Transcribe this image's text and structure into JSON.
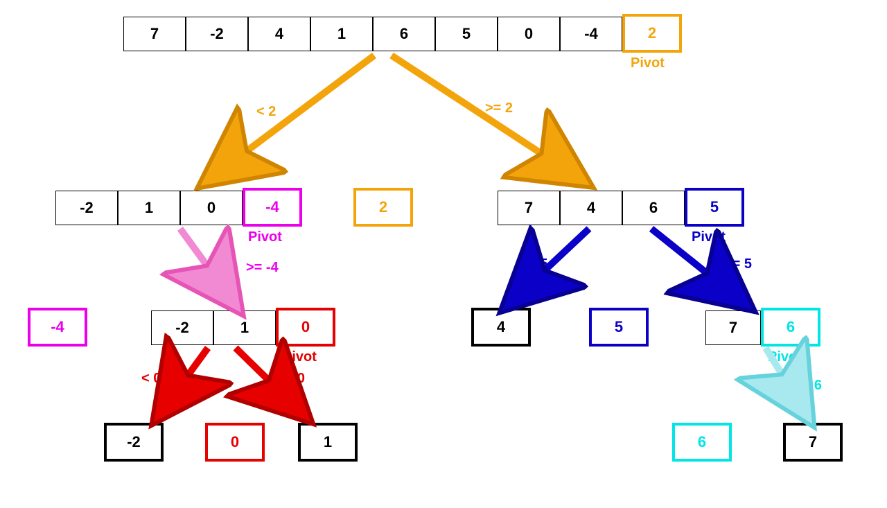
{
  "diagram_type": "quicksort-partition-tree",
  "colors": {
    "orange": "#f4a40b",
    "magenta": "#ec00ec",
    "red": "#e60000",
    "blue": "#0b00c8",
    "cyan": "#00e5e5",
    "black": "#000000"
  },
  "pivot_label": "Pivot",
  "level0": {
    "array": [
      "7",
      "-2",
      "4",
      "1",
      "6",
      "5",
      "0",
      "-4"
    ],
    "pivot": "2",
    "split_left_label": "< 2",
    "split_right_label": ">= 2"
  },
  "level1_left": {
    "array": [
      "-2",
      "1",
      "0"
    ],
    "pivot": "-4",
    "split_right_label": ">= -4"
  },
  "level1_center": {
    "value": "2"
  },
  "level1_right": {
    "array": [
      "7",
      "4",
      "6"
    ],
    "pivot": "5",
    "split_left_label": "< 5",
    "split_right_label": ">= 5"
  },
  "level2_leftA": {
    "value": "-4"
  },
  "level2_leftB": {
    "array": [
      "-2",
      "1"
    ],
    "pivot": "0",
    "split_left_label": "< 0",
    "split_right_label": ">= 0"
  },
  "level2_rightA": {
    "value": "4"
  },
  "level2_rightB": {
    "value": "5"
  },
  "level2_rightC": {
    "array": [
      "7"
    ],
    "pivot": "6",
    "split_right_label": ">= 6"
  },
  "level3_left": {
    "a": "-2",
    "b": "0",
    "c": "1"
  },
  "level3_right": {
    "a": "6",
    "b": "7"
  }
}
